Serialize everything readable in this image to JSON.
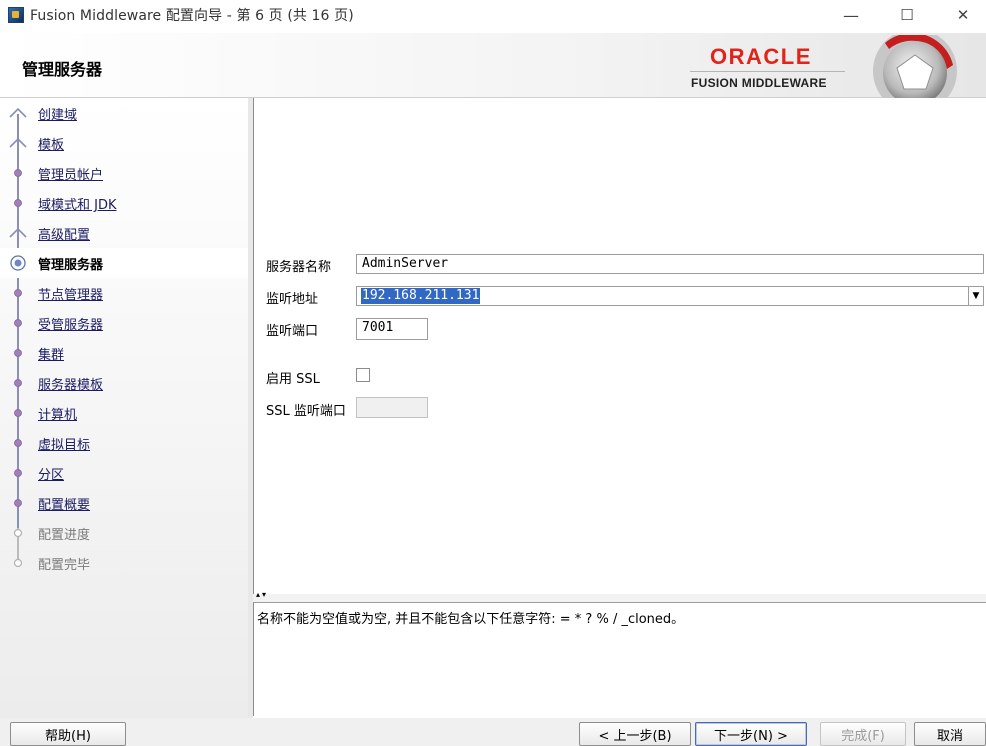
{
  "window": {
    "title": "Fusion Middleware 配置向导 - 第 6 页 (共 16 页)",
    "minimize_glyph": "—",
    "maximize_glyph": "☐",
    "close_glyph": "✕"
  },
  "header": {
    "page_title": "管理服务器",
    "brand_oracle": "ORACLE",
    "brand_product": "FUSION MIDDLEWARE"
  },
  "nav": {
    "items": [
      {
        "label": "创建域",
        "state": "done"
      },
      {
        "label": "模板",
        "state": "done"
      },
      {
        "label": "管理员帐户",
        "state": "pending"
      },
      {
        "label": "域模式和 JDK",
        "state": "pending"
      },
      {
        "label": "高级配置",
        "state": "done"
      },
      {
        "label": "管理服务器",
        "state": "current"
      },
      {
        "label": "节点管理器",
        "state": "pending"
      },
      {
        "label": "受管服务器",
        "state": "pending"
      },
      {
        "label": "集群",
        "state": "pending"
      },
      {
        "label": "服务器模板",
        "state": "pending"
      },
      {
        "label": "计算机",
        "state": "pending"
      },
      {
        "label": "虚拟目标",
        "state": "pending"
      },
      {
        "label": "分区",
        "state": "pending"
      },
      {
        "label": "配置概要",
        "state": "pending"
      },
      {
        "label": "配置进度",
        "state": "disabled"
      },
      {
        "label": "配置完毕",
        "state": "disabled"
      }
    ]
  },
  "form": {
    "server_name_label": "服务器名称",
    "server_name_value": "AdminServer",
    "listen_address_label": "监听地址",
    "listen_address_value": "192.168.211.131",
    "listen_port_label": "监听端口",
    "listen_port_value": "7001",
    "enable_ssl_label": "启用 SSL",
    "enable_ssl_checked": false,
    "ssl_port_label": "SSL 监听端口",
    "ssl_port_value": ""
  },
  "message": {
    "text": "名称不能为空值或为空, 并且不能包含以下任意字符: = * ? % / _cloned。"
  },
  "buttons": {
    "help": "帮助(H)",
    "back": "< 上一步(B)",
    "next": "下一步(N) >",
    "finish": "完成(F)",
    "cancel": "取消"
  },
  "colors": {
    "oracle_red": "#e2231a",
    "selection_blue": "#3168c4",
    "nav_link": "#1b1b66",
    "marker_purple": "#8a8fb8"
  }
}
